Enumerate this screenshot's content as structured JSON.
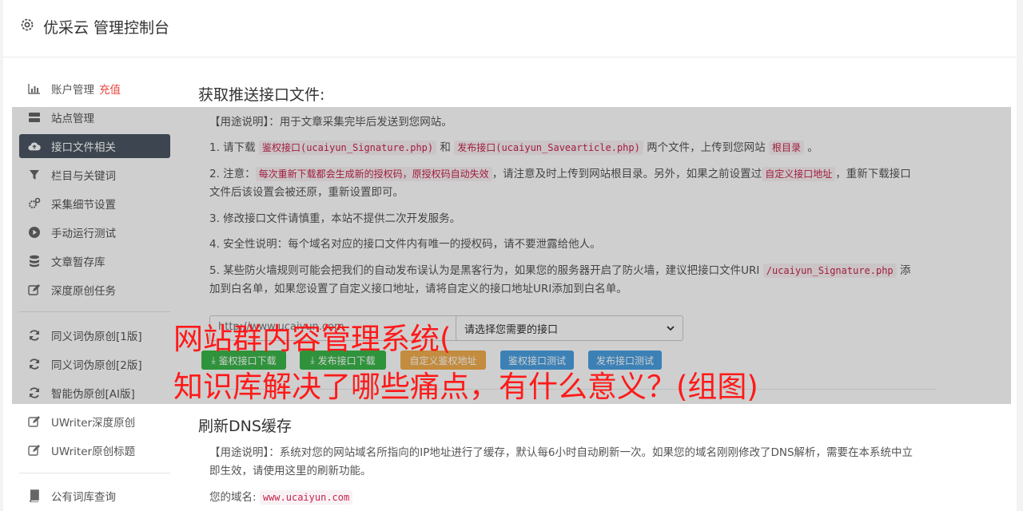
{
  "header": {
    "title": "优采云 管理控制台"
  },
  "sidebar": {
    "items": [
      {
        "label": "账户管理",
        "badge": "充值"
      },
      {
        "label": "站点管理"
      },
      {
        "label": "接口文件相关"
      },
      {
        "label": "栏目与关键词"
      },
      {
        "label": "采集细节设置"
      },
      {
        "label": "手动运行测试"
      },
      {
        "label": "文章暂存库"
      },
      {
        "label": "深度原创任务"
      },
      {
        "label": "同义词伪原创[1版]"
      },
      {
        "label": "同义词伪原创[2版]"
      },
      {
        "label": "智能伪原创[AI版]"
      },
      {
        "label": "UWriter深度原创"
      },
      {
        "label": "UWriter原创标题"
      },
      {
        "label": "公有词库查询"
      }
    ]
  },
  "main": {
    "section1": {
      "title": "获取推送接口文件:",
      "usage": "【用途说明】：用于文章采集完毕后发送到您网站。",
      "s1_a": "1. 请下载 ",
      "s1_code1": "鉴权接口(ucaiyun_Signature.php)",
      "s1_b": " 和 ",
      "s1_code2": "发布接口(ucaiyun_Savearticle.php)",
      "s1_c": " 两个文件，上传到您网站 ",
      "s1_code3": "根目录",
      "s1_d": " 。",
      "s2_a": "2. 注意：",
      "s2_code1": "每次重新下载都会生成新的授权码，原授权码自动失效",
      "s2_b": "，请注意及时上传到网站根目录。另外，如果之前设置过",
      "s2_code2": "自定义接口地址",
      "s2_c": "，重新下载接口文件后该设置会被还原，重新设置即可。",
      "s3": "3. 修改接口文件请慎重，本站不提供二次开发服务。",
      "s4": "4. 安全性说明：每个域名对应的接口文件内有唯一的授权码，请不要泄露给他人。",
      "s5_a": "5. 某些防火墙规则可能会把我们的自动发布误认为是黑客行为，如果您的服务器开启了防火墙，建议把接口文件URI ",
      "s5_code": "/ucaiyun_Signature.php",
      "s5_b": " 添加到白名单，如果您设置了自定义接口地址，请将自定义的接口地址URI添加到白名单。",
      "url_value": "http://www.ucaiyun.com",
      "select_value": "请选择您需要的接口",
      "buttons": {
        "download_auth": "鉴权接口下载",
        "download_publish": "发布接口下载",
        "custom_auth": "自定义鉴权地址",
        "test_auth": "鉴权接口测试",
        "test_publish": "发布接口测试"
      }
    },
    "section2": {
      "title": "刷新DNS缓存",
      "usage": "【用途说明】：系统对您的网站域名所指向的IP地址进行了缓存，默认每6小时自动刷新一次。如果您的域名刚刚修改了DNS解析，需要在本系统中立即生效，请使用这里的刷新功能。",
      "domain_label": "您的域名:",
      "domain_value": "www.ucaiyun.com"
    }
  },
  "watermark": {
    "line1": "网站群内容管理系统(",
    "line2": "知识库解决了哪些痛点，有什么意义？(组图)"
  },
  "colors": {
    "active_bg": "#4b5563",
    "accent_red": "#e8453c",
    "green": "#3ab54a",
    "orange": "#f0ad4e",
    "blue": "#4a9fe0",
    "watermark": "#ff1a1a"
  }
}
